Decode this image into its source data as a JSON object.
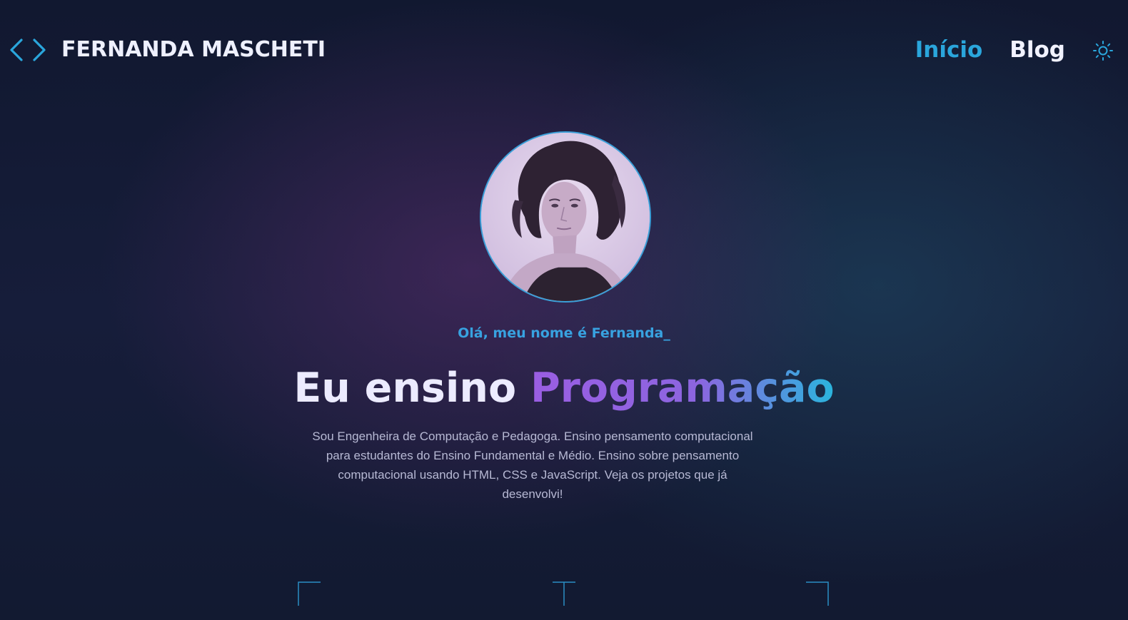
{
  "header": {
    "logo_icon": "code-brackets-icon",
    "brand": "FERNANDA MASCHETI",
    "nav": [
      {
        "label": "Início",
        "active": true
      },
      {
        "label": "Blog",
        "active": false
      }
    ],
    "theme_toggle_icon": "sun-icon"
  },
  "hero": {
    "avatar_alt": "portrait-photo",
    "greeting": "Olá, meu nome é Fernanda_",
    "headline_prefix": "Eu ensino",
    "headline_highlight": "Programação",
    "bio": "Sou Engenheira de Computação e Pedagoga. Ensino pensamento computacional para estudantes do Ensino Fundamental e Médio. Ensino sobre pensamento computacional usando HTML, CSS e JavaScript. Veja os projetos que já desenvolvi!"
  },
  "colors": {
    "accent_blue": "#2aa6dc",
    "gradient_start": "#9a5ee3",
    "gradient_end": "#2ab5dd",
    "background": "#131a31"
  }
}
